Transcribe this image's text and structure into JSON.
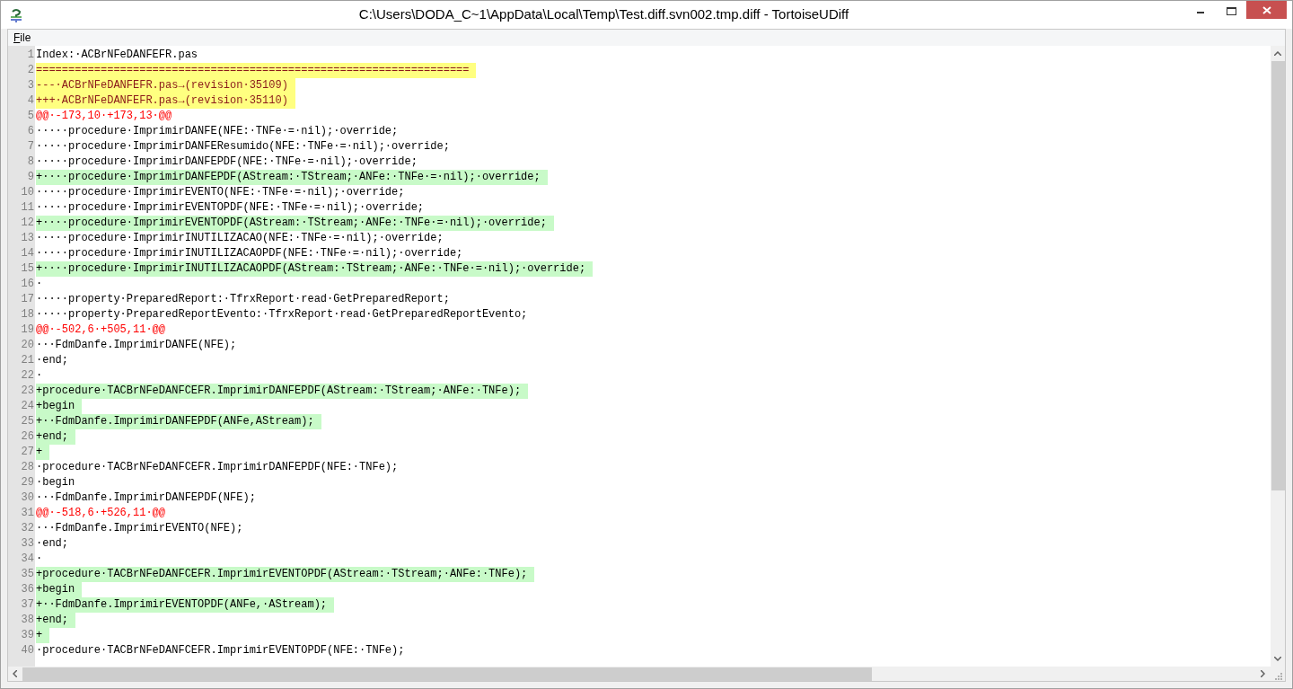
{
  "window": {
    "title": "C:\\Users\\DODA_C~1\\AppData\\Local\\Temp\\Test.diff.svn002.tmp.diff - TortoiseUDiff"
  },
  "menu": [
    {
      "label": "File"
    }
  ],
  "lines": [
    {
      "number": "1",
      "kind": "context",
      "text": "Index:·ACBrNFeDANFEFR.pas"
    },
    {
      "number": "2",
      "kind": "header",
      "text": "==================================================================="
    },
    {
      "number": "3",
      "kind": "header",
      "text": "---·ACBrNFeDANFEFR.pas→(revision·35109)"
    },
    {
      "number": "4",
      "kind": "header",
      "text": "+++·ACBrNFeDANFEFR.pas→(revision·35110)"
    },
    {
      "number": "5",
      "kind": "hunk",
      "text": "@@·-173,10·+173,13·@@"
    },
    {
      "number": "6",
      "kind": "context",
      "text": "·····procedure·ImprimirDANFE(NFE:·TNFe·=·nil);·override;"
    },
    {
      "number": "7",
      "kind": "context",
      "text": "·····procedure·ImprimirDANFEResumido(NFE:·TNFe·=·nil);·override;"
    },
    {
      "number": "8",
      "kind": "context",
      "text": "·····procedure·ImprimirDANFEPDF(NFE:·TNFe·=·nil);·override;"
    },
    {
      "number": "9",
      "kind": "added",
      "text": "+····procedure·ImprimirDANFEPDF(AStream:·TStream;·ANFe:·TNFe·=·nil);·override;"
    },
    {
      "number": "10",
      "kind": "context",
      "text": "·····procedure·ImprimirEVENTO(NFE:·TNFe·=·nil);·override;"
    },
    {
      "number": "11",
      "kind": "context",
      "text": "·····procedure·ImprimirEVENTOPDF(NFE:·TNFe·=·nil);·override;"
    },
    {
      "number": "12",
      "kind": "added",
      "text": "+····procedure·ImprimirEVENTOPDF(AStream:·TStream;·ANFe:·TNFe·=·nil);·override;"
    },
    {
      "number": "13",
      "kind": "context",
      "text": "·····procedure·ImprimirINUTILIZACAO(NFE:·TNFe·=·nil);·override;"
    },
    {
      "number": "14",
      "kind": "context",
      "text": "·····procedure·ImprimirINUTILIZACAOPDF(NFE:·TNFe·=·nil);·override;"
    },
    {
      "number": "15",
      "kind": "added",
      "text": "+····procedure·ImprimirINUTILIZACAOPDF(AStream:·TStream;·ANFe:·TNFe·=·nil);·override;"
    },
    {
      "number": "16",
      "kind": "context",
      "text": "·"
    },
    {
      "number": "17",
      "kind": "context",
      "text": "·····property·PreparedReport:·TfrxReport·read·GetPreparedReport;"
    },
    {
      "number": "18",
      "kind": "context",
      "text": "·····property·PreparedReportEvento:·TfrxReport·read·GetPreparedReportEvento;"
    },
    {
      "number": "19",
      "kind": "hunk",
      "text": "@@·-502,6·+505,11·@@"
    },
    {
      "number": "20",
      "kind": "context",
      "text": "···FdmDanfe.ImprimirDANFE(NFE);"
    },
    {
      "number": "21",
      "kind": "context",
      "text": "·end;"
    },
    {
      "number": "22",
      "kind": "context",
      "text": "·"
    },
    {
      "number": "23",
      "kind": "added",
      "text": "+procedure·TACBrNFeDANFCEFR.ImprimirDANFEPDF(AStream:·TStream;·ANFe:·TNFe);"
    },
    {
      "number": "24",
      "kind": "added",
      "text": "+begin"
    },
    {
      "number": "25",
      "kind": "added",
      "text": "+··FdmDanfe.ImprimirDANFEPDF(ANFe,AStream);"
    },
    {
      "number": "26",
      "kind": "added",
      "text": "+end;"
    },
    {
      "number": "27",
      "kind": "added",
      "text": "+"
    },
    {
      "number": "28",
      "kind": "context",
      "text": "·procedure·TACBrNFeDANFCEFR.ImprimirDANFEPDF(NFE:·TNFe);"
    },
    {
      "number": "29",
      "kind": "context",
      "text": "·begin"
    },
    {
      "number": "30",
      "kind": "context",
      "text": "···FdmDanfe.ImprimirDANFEPDF(NFE);"
    },
    {
      "number": "31",
      "kind": "hunk",
      "text": "@@·-518,6·+526,11·@@"
    },
    {
      "number": "32",
      "kind": "context",
      "text": "···FdmDanfe.ImprimirEVENTO(NFE);"
    },
    {
      "number": "33",
      "kind": "context",
      "text": "·end;"
    },
    {
      "number": "34",
      "kind": "context",
      "text": "·"
    },
    {
      "number": "35",
      "kind": "added",
      "text": "+procedure·TACBrNFeDANFCEFR.ImprimirEVENTOPDF(AStream:·TStream;·ANFe:·TNFe);"
    },
    {
      "number": "36",
      "kind": "added",
      "text": "+begin"
    },
    {
      "number": "37",
      "kind": "added",
      "text": "+··FdmDanfe.ImprimirEVENTOPDF(ANFe,·AStream);"
    },
    {
      "number": "38",
      "kind": "added",
      "text": "+end;"
    },
    {
      "number": "39",
      "kind": "added",
      "text": "+"
    },
    {
      "number": "40",
      "kind": "context",
      "text": "·procedure·TACBrNFeDANFCEFR.ImprimirEVENTOPDF(NFE:·TNFe);"
    }
  ]
}
